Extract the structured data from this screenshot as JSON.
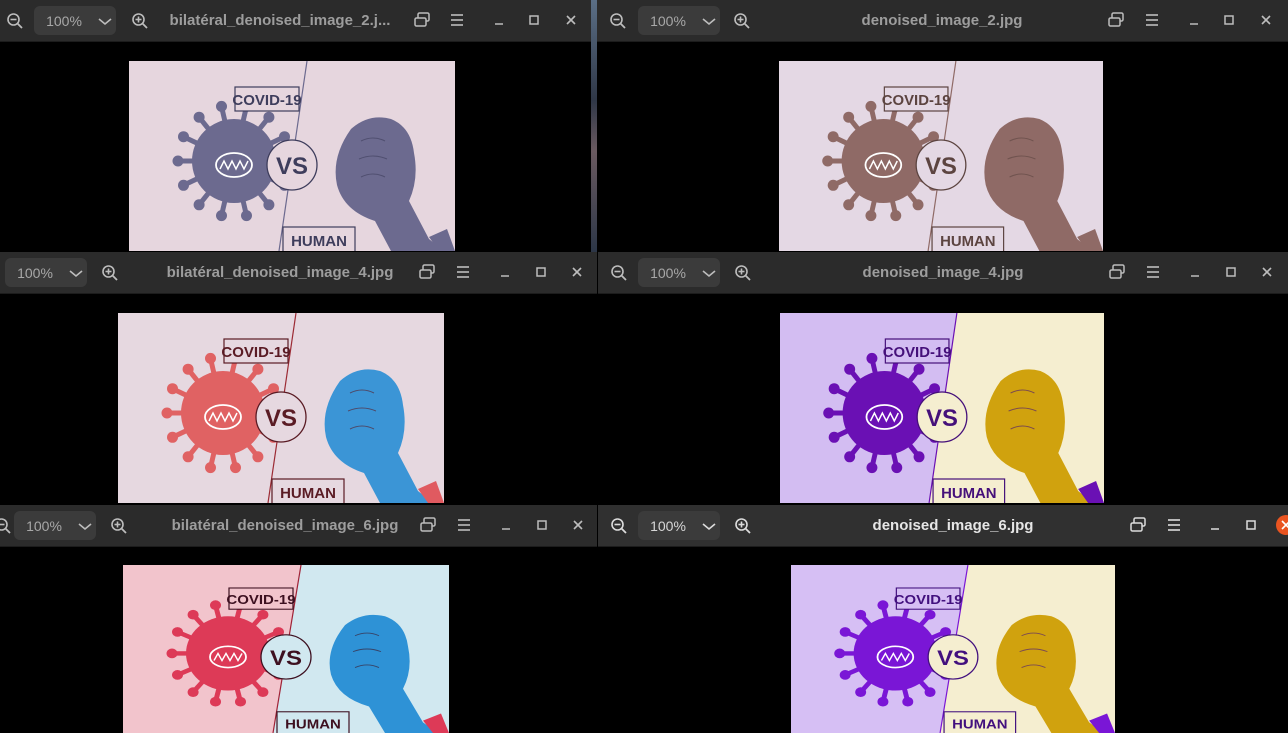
{
  "windows": [
    {
      "title": "bilatéral_denoised_image_2.j...",
      "zoom": "100%"
    },
    {
      "title": "denoised_image_2.jpg",
      "zoom": "100%"
    },
    {
      "title": "bilatéral_denoised_image_4.jpg",
      "zoom": "100%"
    },
    {
      "title": "denoised_image_4.jpg",
      "zoom": "100%"
    },
    {
      "title": "bilatéral_denoised_image_6.jpg",
      "zoom": "100%"
    },
    {
      "title": "denoised_image_6.jpg",
      "zoom": "100%"
    }
  ],
  "poster": {
    "covid": "COVID-19",
    "vs": "VS",
    "human": "HUMAN"
  },
  "palettes": {
    "w0": {
      "left": "#e6d6de",
      "right": "#e6d6de",
      "virus": "#6c6a8f",
      "fist": "#6c6a8f",
      "sleeve": "#6c6a8f",
      "ink": "#3e3d5c",
      "line": "#6c6a8f"
    },
    "w1": {
      "left": "#e4d8e4",
      "right": "#e4d8e4",
      "virus": "#8f6a66",
      "fist": "#8f6a66",
      "sleeve": "#8f6a66",
      "ink": "#5c4440",
      "line": "#8f6a66"
    },
    "w2": {
      "left": "#e6d8e0",
      "right": "#e6d8e0",
      "virus": "#e06263",
      "fist": "#3b95d6",
      "sleeve": "#e05a60",
      "ink": "#5a1b24",
      "line": "#9c2b34"
    },
    "w3": {
      "left": "#d3bdf2",
      "right": "#f5eed0",
      "virus": "#6a10b4",
      "fist": "#d0a20e",
      "sleeve": "#6a10b4",
      "ink": "#45107a",
      "line": "#6a10b4"
    },
    "w4": {
      "left": "#f2c4cc",
      "right": "#d1e8f0",
      "virus": "#dd3a57",
      "fist": "#2e92d6",
      "sleeve": "#dd3a57",
      "ink": "#3d1020",
      "line": "#a02236"
    },
    "w5": {
      "left": "#d6bff4",
      "right": "#f5eed0",
      "virus": "#7a16d6",
      "fist": "#d0a20e",
      "sleeve": "#7a16d6",
      "ink": "#42107e",
      "line": "#7a16d6"
    }
  }
}
